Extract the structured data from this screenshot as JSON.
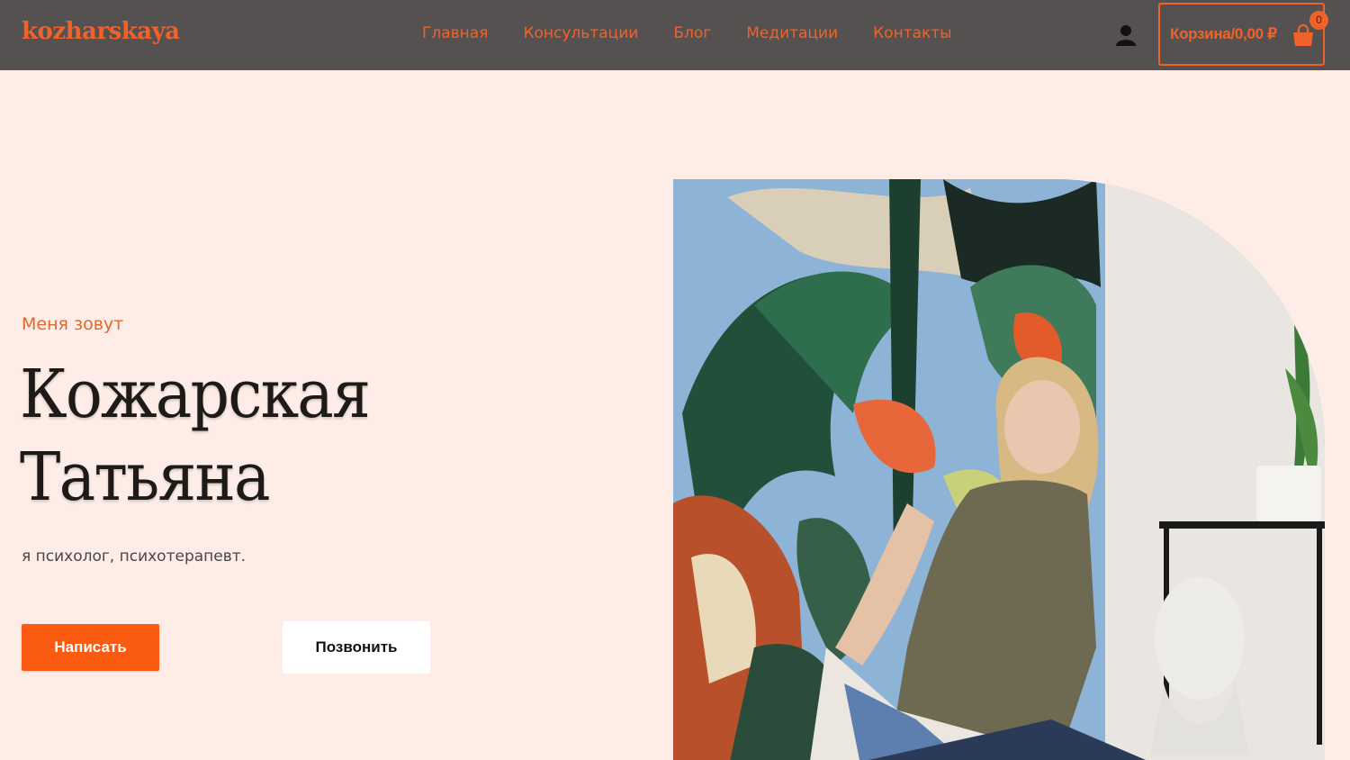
{
  "header": {
    "logo": "kozharskaya",
    "nav": [
      "Главная",
      "Консультации",
      "Блог",
      "Медитации",
      "Контакты"
    ],
    "cart_label": "Корзина/0,00 ₽",
    "cart_count": "0",
    "icons": [
      "user-icon",
      "shopping-bag-icon"
    ]
  },
  "hero": {
    "eyebrow": "Меня зовут",
    "name_line1": "Кожарская",
    "name_line2": "Татьяна",
    "subtitle": "я психолог, психотерапевт.",
    "primary_button": "Написать",
    "secondary_button": "Позвонить"
  },
  "colors": {
    "accent": "#f0622a",
    "header_bg": "#555150",
    "page_bg": "#fdede6",
    "button_primary": "#fb5a12"
  }
}
